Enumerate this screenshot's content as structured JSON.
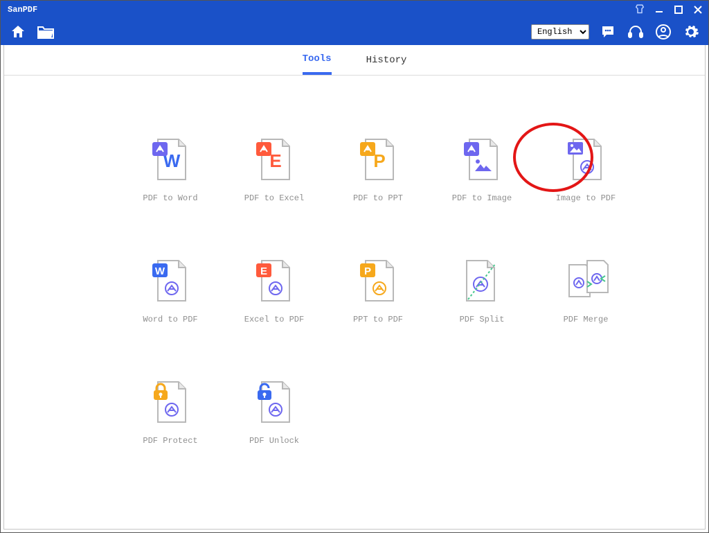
{
  "app": {
    "title": "SanPDF"
  },
  "toolbar": {
    "language": "English"
  },
  "tabs": {
    "tools": "Tools",
    "history": "History"
  },
  "tools": {
    "pdf_to_word": {
      "label": "PDF to Word",
      "badge": "W",
      "badge_color": "#3a6af0",
      "letter_color": "#3a6af0"
    },
    "pdf_to_excel": {
      "label": "PDF to Excel",
      "badge": "E",
      "badge_color": "#ff5a3c",
      "letter_color": "#ff5a3c"
    },
    "pdf_to_ppt": {
      "label": "PDF to PPT",
      "badge": "P",
      "badge_color": "#f6a81c",
      "letter_color": "#f6a81c"
    },
    "pdf_to_image": {
      "label": "PDF to Image"
    },
    "image_to_pdf": {
      "label": "Image to PDF"
    },
    "word_to_pdf": {
      "label": "Word to PDF",
      "badge": "W",
      "badge_color": "#3a6af0"
    },
    "excel_to_pdf": {
      "label": "Excel to PDF",
      "badge": "E",
      "badge_color": "#ff5a3c"
    },
    "ppt_to_pdf": {
      "label": "PPT to PDF",
      "badge": "P",
      "badge_color": "#f6a81c"
    },
    "pdf_split": {
      "label": "PDF Split"
    },
    "pdf_merge": {
      "label": "PDF Merge"
    },
    "pdf_protect": {
      "label": "PDF Protect"
    },
    "pdf_unlock": {
      "label": "PDF Unlock"
    }
  }
}
